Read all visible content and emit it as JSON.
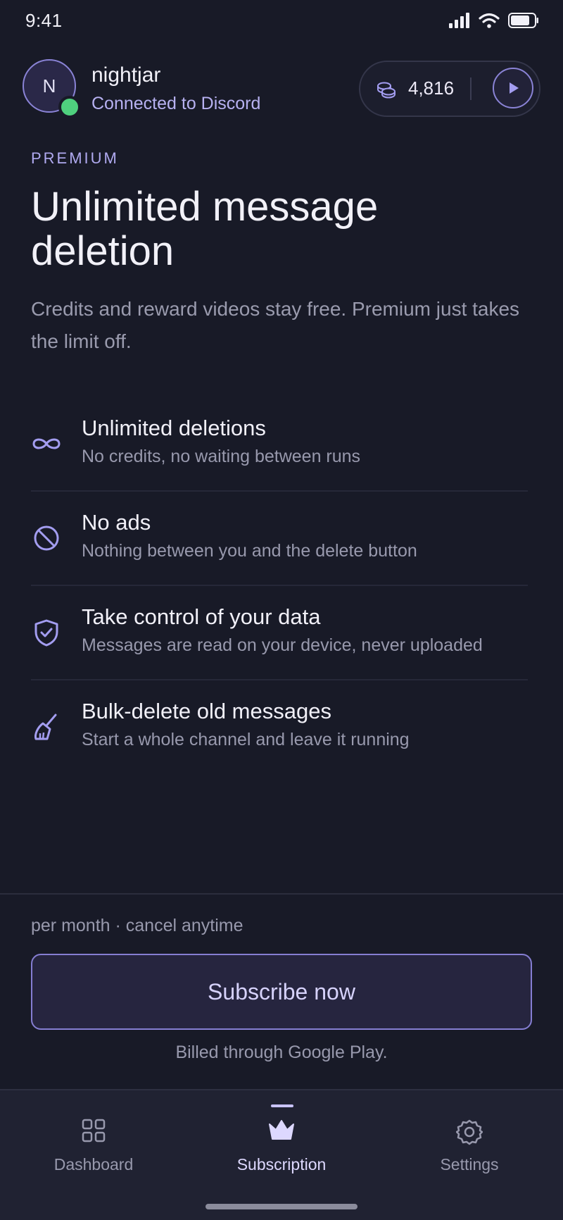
{
  "status_bar": {
    "time": "9:41"
  },
  "header": {
    "avatar_initial": "N",
    "username": "nightjar",
    "connection_status": "Connected to Discord",
    "credits": "4,816"
  },
  "hero": {
    "eyebrow": "PREMIUM",
    "title": "Unlimited message deletion",
    "subtitle": "Credits and reward videos stay free. Premium just takes the limit off."
  },
  "features": [
    {
      "icon": "infinity-icon",
      "title": "Unlimited deletions",
      "description": "No credits, no waiting between runs"
    },
    {
      "icon": "no-ads-icon",
      "title": "No ads",
      "description": "Nothing between you and the delete button"
    },
    {
      "icon": "shield-check-icon",
      "title": "Take control of your data",
      "description": "Messages are read on your device, never uploaded"
    },
    {
      "icon": "broom-icon",
      "title": "Bulk-delete old messages",
      "description": "Start a whole channel and leave it running"
    }
  ],
  "purchase": {
    "price_note": "per month · cancel anytime",
    "subscribe_label": "Subscribe now",
    "billing_note": "Billed through Google Play."
  },
  "tabs": [
    {
      "label": "Dashboard",
      "icon": "grid-icon",
      "active": false
    },
    {
      "label": "Subscription",
      "icon": "crown-icon",
      "active": true
    },
    {
      "label": "Settings",
      "icon": "gear-icon",
      "active": false
    }
  ],
  "colors": {
    "background": "#181a27",
    "accent": "#8a83d6",
    "online": "#4fd07e",
    "muted_text": "#9899ad"
  }
}
